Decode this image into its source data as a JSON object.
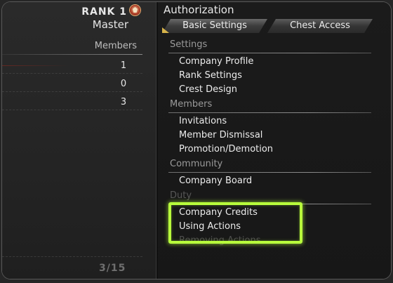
{
  "left_panel": {
    "rank_label": "RANK 1",
    "rank_name": "Master",
    "members_header": "Members",
    "counts": [
      "1",
      "0",
      "3"
    ],
    "pager": "3/15"
  },
  "right_panel": {
    "title": "Authorization",
    "tabs": [
      {
        "label": "Basic Settings",
        "selected": true
      },
      {
        "label": "Chest Access",
        "selected": false
      }
    ],
    "sections": {
      "settings": {
        "label": "Settings",
        "items": [
          "Company Profile",
          "Rank Settings",
          "Crest Design"
        ]
      },
      "members": {
        "label": "Members",
        "items": [
          "Invitations",
          "Member Dismissal",
          "Promotion/Demotion"
        ]
      },
      "community": {
        "label": "Community",
        "items": [
          "Company Board"
        ]
      },
      "duty": {
        "label": "Duty",
        "items": [
          "Company Credits",
          "Using Actions",
          "Removing Actions"
        ]
      }
    }
  },
  "colors": {
    "highlight": "#b8ff3c",
    "tab_marker": "#d7b34a",
    "rank_icon": "#b2412a"
  },
  "icons": {
    "rank": "rank-emblem-icon",
    "tab_marker": "tab-corner-marker-icon"
  }
}
